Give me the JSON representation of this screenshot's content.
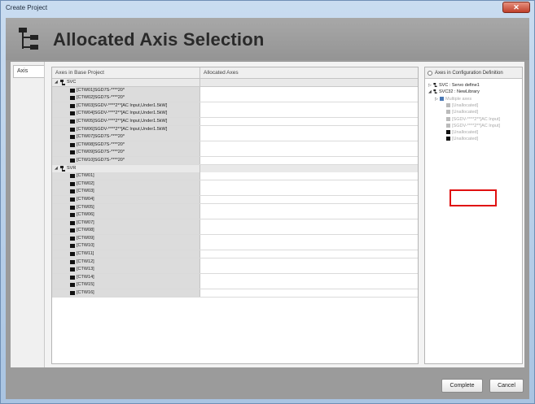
{
  "window": {
    "title": "Create Project",
    "close_glyph": "✕"
  },
  "header": {
    "title": "Allocated Axis Selection",
    "icon": "axis-tree-icon"
  },
  "side_tabs": [
    {
      "label": "Axis"
    }
  ],
  "grid": {
    "columns": [
      "Axes in Base Project",
      "Allocated Axes"
    ],
    "groups": [
      {
        "label": "SVC",
        "axes": [
          "[CTW01]SGD7S-****20*",
          "[CTW02]SGD7S-****20*",
          "[CTW03]SGDV-****2**[AC Input,Under1.5kW]",
          "[CTW04]SGDV-****2**[AC Input,Under1.5kW]",
          "[CTW05]SGDV-****2**[AC Input,Under1.5kW]",
          "[CTW06]SGDV-****2**[AC Input,Under1.5kW]",
          "[CTW07]SGD7S-****20*",
          "[CTW08]SGD7S-****20*",
          "[CTW09]SGD7S-****20*",
          "[CTW10]SGD7S-****20*"
        ]
      },
      {
        "label": "SVR",
        "axes": [
          "[CTW01]",
          "[CTW02]",
          "[CTW03]",
          "[CTW04]",
          "[CTW05]",
          "[CTW06]",
          "[CTW07]",
          "[CTW08]",
          "[CTW09]",
          "[CTW10]",
          "[CTW11]",
          "[CTW12]",
          "[CTW13]",
          "[CTW14]",
          "[CTW15]",
          "[CTW16]"
        ]
      }
    ]
  },
  "right_panel": {
    "title": "Axes in Configuration Definition",
    "tree": [
      {
        "text": "SVC : Servo define1",
        "level": 0,
        "icon": "group",
        "dim": false,
        "expander": "▷"
      },
      {
        "text": "SVC32 : NewLibrary",
        "level": 0,
        "icon": "group",
        "dim": false,
        "expander": "◢"
      },
      {
        "text": "Multiple axes",
        "level": 1,
        "icon": "blue",
        "dim": true,
        "expander": "▷"
      },
      {
        "text": "[Unallocated]",
        "level": 2,
        "icon": "grey",
        "dim": true,
        "expander": ""
      },
      {
        "text": "[Unallocated]",
        "level": 2,
        "icon": "grey",
        "dim": true,
        "expander": ""
      },
      {
        "text": "[SGDV-****2**[AC Input]",
        "level": 2,
        "icon": "grey",
        "dim": true,
        "expander": ""
      },
      {
        "text": "[SGDV-****2**[AC Input]",
        "level": 2,
        "icon": "grey",
        "dim": true,
        "expander": ""
      },
      {
        "text": "[Unallocated]",
        "level": 2,
        "icon": "black",
        "dim": true,
        "expander": ""
      },
      {
        "text": "[Unallocated]",
        "level": 2,
        "icon": "black",
        "dim": true,
        "expander": ""
      }
    ]
  },
  "footer": {
    "complete_label": "Complete",
    "cancel_label": "Cancel"
  },
  "colors": {
    "highlight": "#e01010",
    "header_bg": "#a0a0a0"
  }
}
